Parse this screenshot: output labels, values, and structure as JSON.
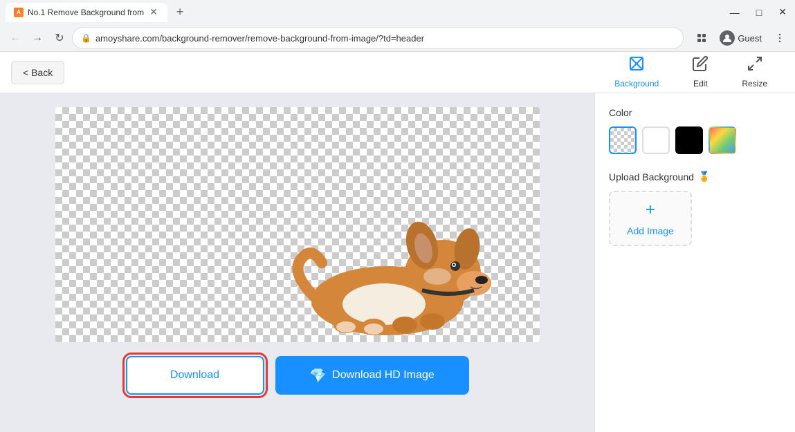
{
  "browser": {
    "tab_title": "No.1 Remove Background from",
    "tab_favicon": "A",
    "new_tab_label": "+",
    "address": "amoyshare.com/background-remover/remove-background-from-image/?td=header",
    "guest_label": "Guest",
    "window_controls": {
      "minimize": "—",
      "maximize": "□",
      "close": "✕"
    }
  },
  "toolbar": {
    "back_label": "< Back"
  },
  "panel_tabs": [
    {
      "id": "background",
      "label": "Background",
      "icon": "⊘",
      "active": true
    },
    {
      "id": "edit",
      "label": "Edit",
      "icon": "✎",
      "active": false
    },
    {
      "id": "resize",
      "label": "Resize",
      "icon": "⤡",
      "active": false
    }
  ],
  "right_panel": {
    "color_section": {
      "title": "Color",
      "swatches": [
        {
          "id": "transparent",
          "type": "transparent",
          "selected": true
        },
        {
          "id": "white",
          "type": "white",
          "selected": false
        },
        {
          "id": "black",
          "type": "black",
          "selected": false
        },
        {
          "id": "gradient",
          "type": "gradient",
          "selected": false
        }
      ]
    },
    "upload_section": {
      "title": "Upload Background",
      "add_image_label": "Add Image"
    }
  },
  "download": {
    "download_label": "Download",
    "download_hd_label": "Download HD Image",
    "diamond_icon": "◆"
  },
  "colors": {
    "accent": "#1890ff",
    "danger": "#e53935"
  }
}
